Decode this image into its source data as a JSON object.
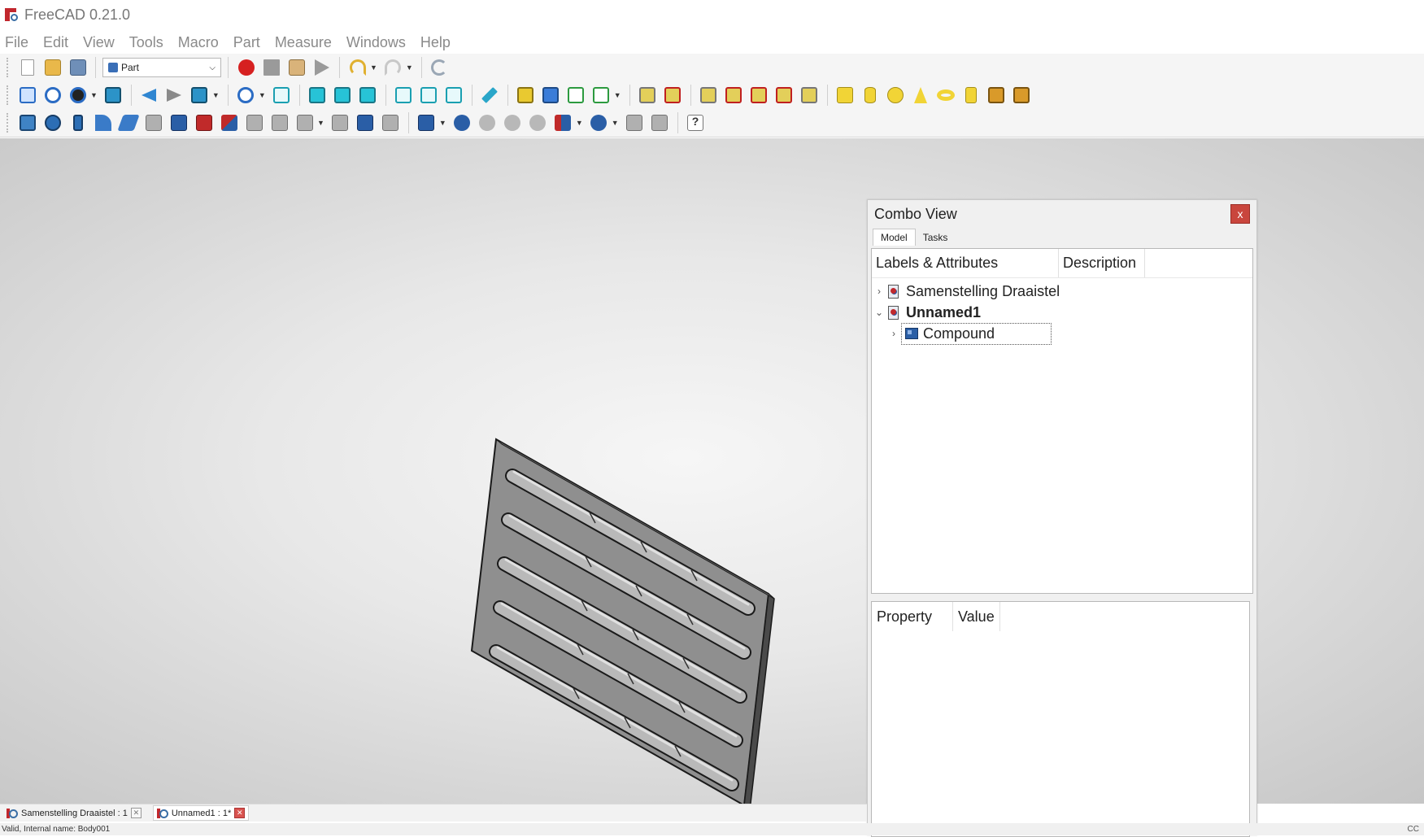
{
  "window": {
    "title": "FreeCAD 0.21.0"
  },
  "menu": [
    "File",
    "Edit",
    "View",
    "Tools",
    "Macro",
    "Part",
    "Measure",
    "Windows",
    "Help"
  ],
  "toolbar": {
    "workbench_selected": "Part"
  },
  "combo_view": {
    "title": "Combo View",
    "close_label": "x",
    "tabs": [
      "Model",
      "Tasks"
    ],
    "tree_columns": [
      "Labels & Attributes",
      "Description"
    ],
    "tree_items": [
      {
        "label": "Samenstelling Draaistel",
        "expanded": false,
        "bold": false
      },
      {
        "label": "Unnamed1",
        "expanded": true,
        "bold": true
      },
      {
        "label": "Compound",
        "expanded": false,
        "bold": false,
        "selected": true
      }
    ],
    "property_columns": [
      "Property",
      "Value"
    ]
  },
  "document_tabs": [
    {
      "label": "Samenstelling Draaistel : 1",
      "active": false
    },
    {
      "label": "Unnamed1 : 1*",
      "active": true
    }
  ],
  "status": {
    "text": "Valid, Internal name: Body001",
    "right_text": "CC"
  },
  "colors": {
    "accent_red": "#c1272d",
    "close_red": "#c9463d",
    "model_grey": "#9a9a9a"
  }
}
